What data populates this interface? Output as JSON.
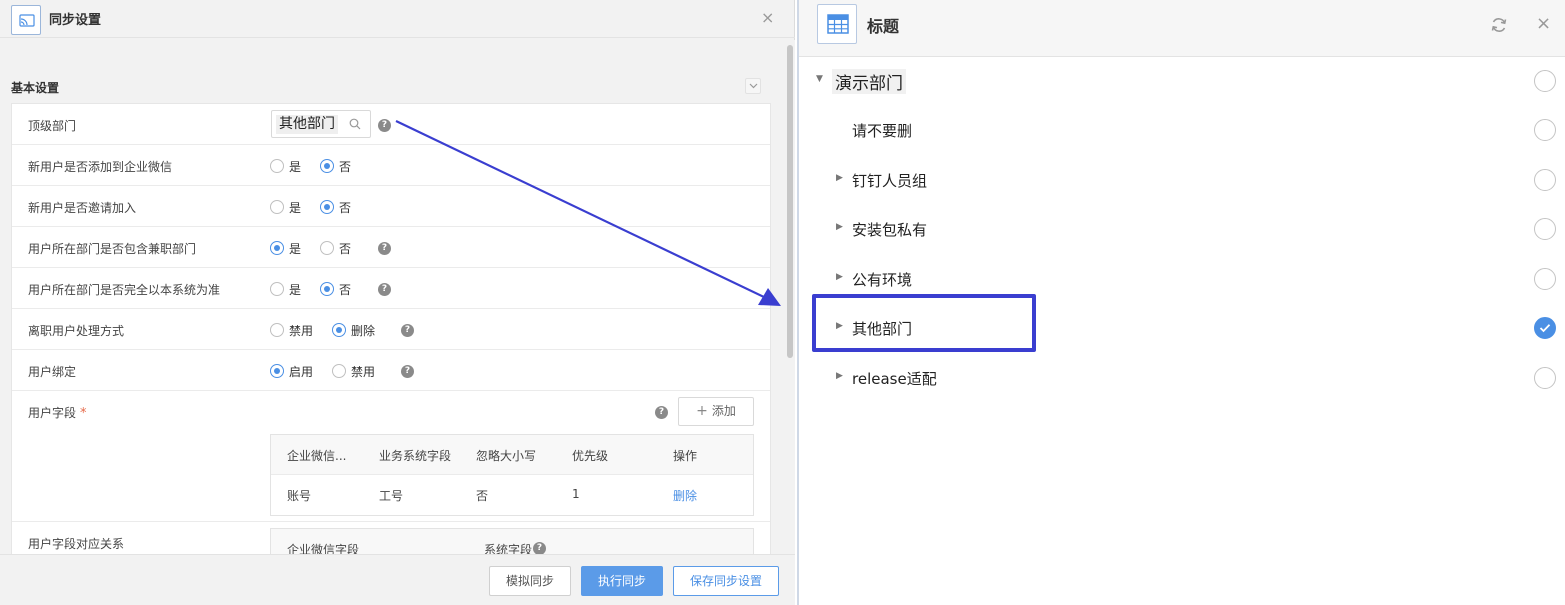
{
  "left_dialog": {
    "title": "同步设置",
    "section_title": "基本设置",
    "rows": {
      "top_department": {
        "label": "顶级部门",
        "value": "其他部门"
      },
      "add_to_wecom": {
        "label": "新用户是否添加到企业微信",
        "yes": "是",
        "no": "否",
        "selected": "no"
      },
      "invite_join": {
        "label": "新用户是否邀请加入",
        "yes": "是",
        "no": "否",
        "selected": "no"
      },
      "include_parttime": {
        "label": "用户所在部门是否包含兼职部门",
        "yes": "是",
        "no": "否",
        "selected": "yes"
      },
      "system_authority": {
        "label": "用户所在部门是否完全以本系统为准",
        "yes": "是",
        "no": "否",
        "selected": "no"
      },
      "departed_handling": {
        "label": "离职用户处理方式",
        "option1": "禁用",
        "option2": "删除",
        "selected": "option2"
      },
      "user_binding": {
        "label": "用户绑定",
        "option1": "启用",
        "option2": "禁用",
        "selected": "option1"
      },
      "user_fields": {
        "label": "用户字段",
        "add_label": "添加",
        "headers": [
          "企业微信...",
          "业务系统字段",
          "忽略大小写",
          "优先级",
          "操作"
        ],
        "rows": [
          {
            "wecom_field": "账号",
            "system_field": "工号",
            "ignore_case": "否",
            "priority": "1",
            "action": "删除"
          }
        ]
      },
      "field_mapping": {
        "label": "用户字段对应关系",
        "headers": [
          "企业微信字段",
          "系统字段"
        ]
      }
    },
    "footer": {
      "simulate": "模拟同步",
      "run": "执行同步",
      "save": "保存同步设置"
    },
    "help_glyph": "?"
  },
  "right_dialog": {
    "title": "标题",
    "tree": [
      {
        "label": "演示部门",
        "level": 0,
        "caret": "expanded",
        "selected": false
      },
      {
        "label": "请不要删",
        "level": 1,
        "caret": "none",
        "selected": false
      },
      {
        "label": "钉钉人员组",
        "level": 1,
        "caret": "collapsed",
        "selected": false
      },
      {
        "label": "安装包私有",
        "level": 1,
        "caret": "collapsed",
        "selected": false
      },
      {
        "label": "公有环境",
        "level": 1,
        "caret": "collapsed",
        "selected": false
      },
      {
        "label": "其他部门",
        "level": 1,
        "caret": "collapsed",
        "selected": true
      },
      {
        "label": "release适配",
        "level": 1,
        "caret": "collapsed",
        "selected": false
      }
    ]
  },
  "colors": {
    "accent": "#4a8fe4",
    "annotation": "#3a3ed0",
    "required": "#e66a4a"
  },
  "icons": {
    "caret_expanded": "▼",
    "caret_collapsed": "▶",
    "close": "×",
    "plus": "+"
  }
}
